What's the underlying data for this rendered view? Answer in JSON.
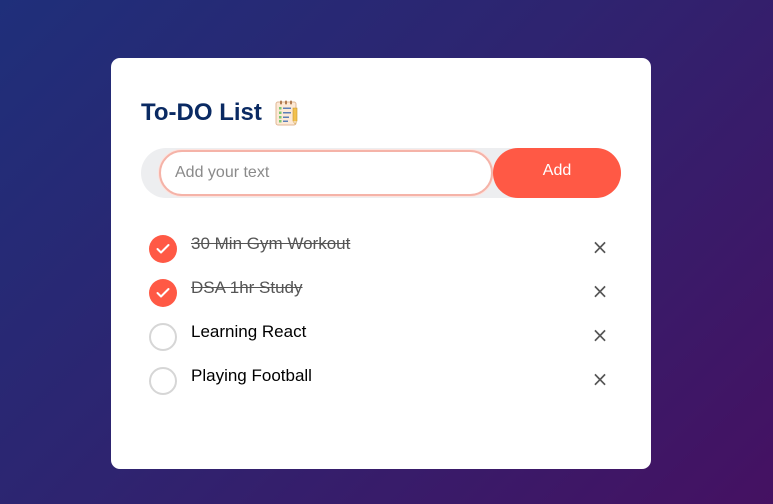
{
  "app": {
    "title": "To-DO List",
    "title_icon": "notepad-icon"
  },
  "input": {
    "value": "",
    "placeholder": "Add your text"
  },
  "add_button": {
    "label": "Add"
  },
  "tasks": [
    {
      "text": "30 Min Gym Workout",
      "completed": true
    },
    {
      "text": "DSA 1hr Study",
      "completed": true
    },
    {
      "text": "Learning React",
      "completed": false
    },
    {
      "text": "Playing Football",
      "completed": false
    }
  ],
  "remove_glyph": "×",
  "colors": {
    "accent": "#ff5945",
    "title": "#0a2a63",
    "background_start": "#1f2f7a",
    "background_end": "#451162"
  }
}
